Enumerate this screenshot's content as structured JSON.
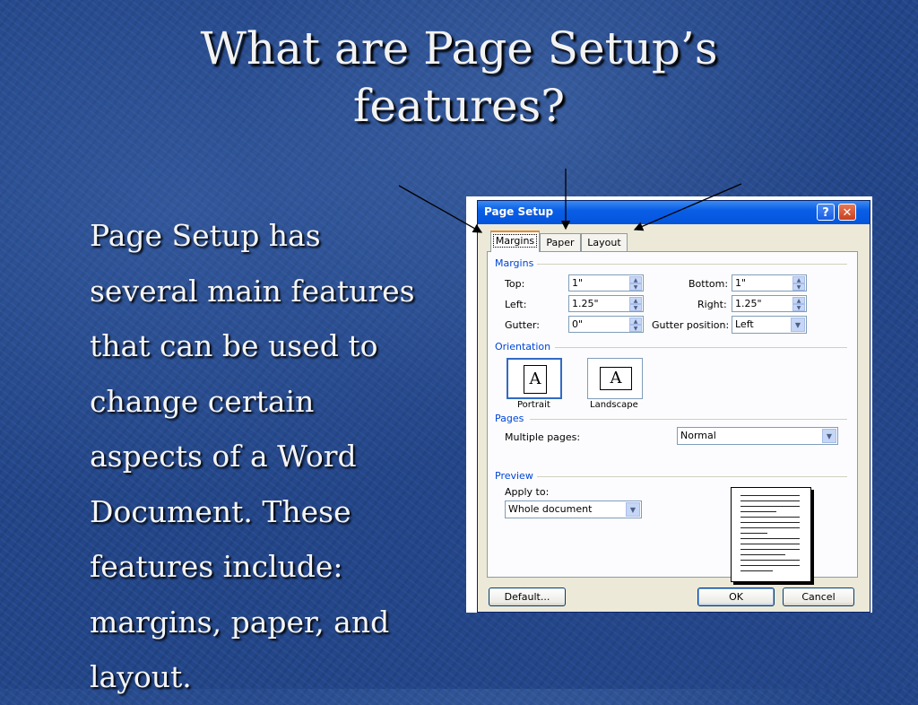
{
  "slide": {
    "title_line1": "What are Page Setup’s",
    "title_line2": "features?",
    "body_lines": [
      "Page Setup has",
      "several main features",
      "that can be used to",
      "change certain",
      "aspects of a Word",
      "Document.  These",
      "features include:",
      "margins, paper, and",
      "layout."
    ]
  },
  "dialog": {
    "title": "Page Setup",
    "help_label": "?",
    "close_label": "✕",
    "tabs": [
      "Margins",
      "Paper",
      "Layout"
    ],
    "active_tab": "Margins",
    "margins": {
      "group_label": "Margins",
      "top_label": "Top:",
      "top_value": "1\"",
      "bottom_label": "Bottom:",
      "bottom_value": "1\"",
      "left_label": "Left:",
      "left_value": "1.25\"",
      "right_label": "Right:",
      "right_value": "1.25\"",
      "gutter_label": "Gutter:",
      "gutter_value": "0\"",
      "gutter_position_label": "Gutter position:",
      "gutter_position_value": "Left"
    },
    "orientation": {
      "group_label": "Orientation",
      "portrait_label": "Portrait",
      "landscape_label": "Landscape",
      "icon_letter": "A",
      "selected": "Portrait"
    },
    "pages": {
      "group_label": "Pages",
      "multiple_pages_label": "Multiple pages:",
      "multiple_pages_value": "Normal"
    },
    "preview": {
      "group_label": "Preview",
      "apply_to_label": "Apply to:",
      "apply_to_value": "Whole document"
    },
    "buttons": {
      "default": "Default...",
      "ok": "OK",
      "cancel": "Cancel"
    },
    "colors": {
      "titlebar": "#0a5ee6",
      "group_label": "#0046d5",
      "active_tab_accent": "#e68b2c"
    }
  }
}
